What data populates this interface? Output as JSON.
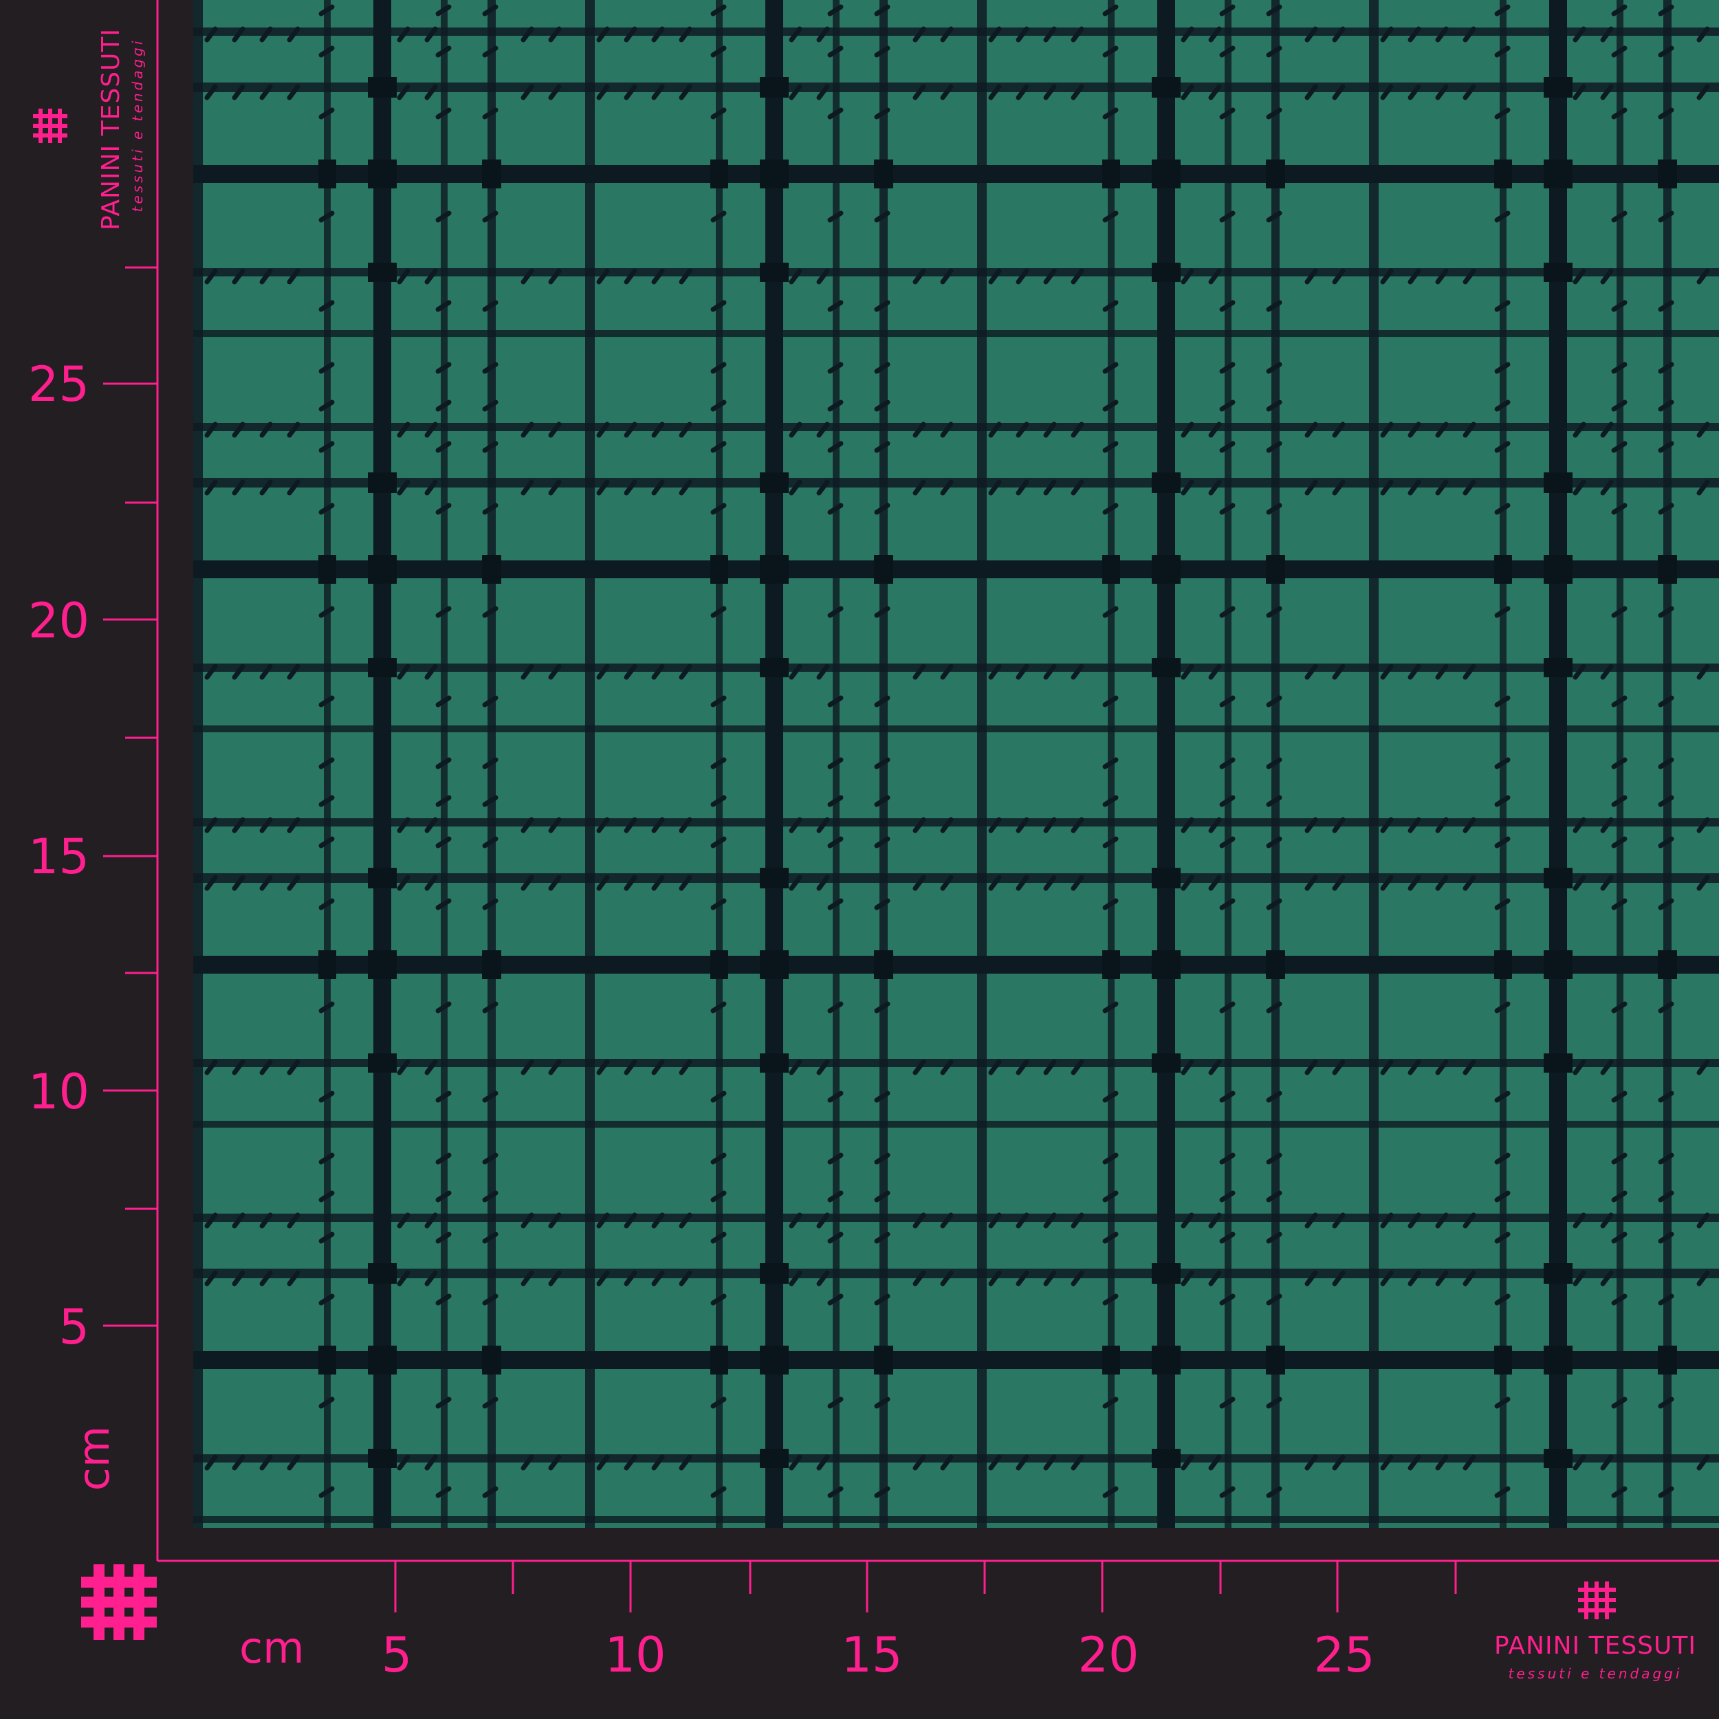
{
  "ruler_color": "#ff1f8e",
  "background_color": "#221e21",
  "fabric": {
    "base_color": "#2a7864",
    "check_color": "#0e1a22",
    "pattern": "houndstooth-check"
  },
  "vertical_ruler": {
    "unit": "cm",
    "labels": [
      "5",
      "10",
      "15",
      "20",
      "25"
    ]
  },
  "horizontal_ruler": {
    "unit": "cm",
    "labels": [
      "5",
      "10",
      "15",
      "20",
      "25"
    ]
  },
  "brand_top": {
    "icon": "grid-hash-icon",
    "name": "PANINI TESSUTI",
    "tagline": "tessuti e tendaggi"
  },
  "brand_bottom": {
    "icon": "grid-hash-icon",
    "name": "PANINI TESSUTI",
    "tagline": "tessuti e tendaggi"
  },
  "corner_logo": {
    "icon": "large-grid-hash-icon"
  }
}
